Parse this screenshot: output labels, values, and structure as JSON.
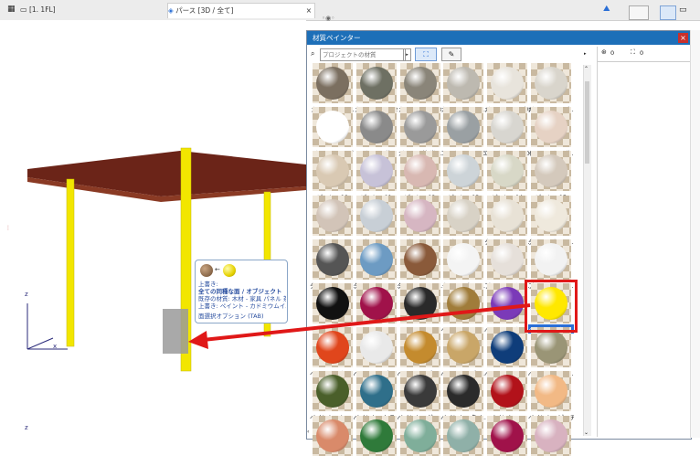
{
  "tabs": [
    {
      "label": "[1. 1FL]"
    },
    {
      "label": "パース [3D / 全て]"
    }
  ],
  "tab_close": "×",
  "panel": {
    "title": "材質ペインター",
    "close": "×",
    "search_placeholder": "プロジェクトの材質",
    "counts": {
      "a": "0",
      "b": "0"
    }
  },
  "tooltip": {
    "line1": "上書き:",
    "line2": "全ての同種な面 / オブジェクト",
    "line3": "既存の材質: 木材 - 家具 パネル 茶",
    "line4": "上書き: ペイント - カドミウムイエロー",
    "line5": "面選択オプション (TAB)"
  },
  "axes": {
    "z": "z",
    "x": "x"
  },
  "materials": [
    {
      "label": "カーペット - 01",
      "color": "#7b6f60"
    },
    {
      "label": "カーペット - 02",
      "color": "#6e7063"
    },
    {
      "label": "カーペット - 03",
      "color": "#8a8579"
    },
    {
      "label": "カーペット - 3...",
      "color": "#bdb9b0"
    },
    {
      "label": "ガラス - シンプル",
      "color": "#e8e4dc"
    },
    {
      "label": "ガラス - シンプ...",
      "color": "#d9d5cc"
    },
    {
      "label": "ガラス - ランプ",
      "color": "#ffffff"
    },
    {
      "label": "ガラス - 鏡",
      "color": "#8a8a8a"
    },
    {
      "label": "ガラス - 鏡 半...",
      "color": "#9a9a9a"
    },
    {
      "label": "コンクリート - 03",
      "color": "#9aa0a3"
    },
    {
      "label": "コンクリート - 04",
      "color": "#d8d6d0"
    },
    {
      "label": "セラミック - 磁...",
      "color": "#e6d2c4"
    },
    {
      "label": "ゾーン - 00",
      "color": "#d9c9b3"
    },
    {
      "label": "ゾーン - 01",
      "color": "#c7c2d8"
    },
    {
      "label": "ゾーン - 02",
      "color": "#d8b8b2"
    },
    {
      "label": "ゾーン - 03",
      "color": "#cdd4d8"
    },
    {
      "label": "ゾーン - 04",
      "color": "#d8d8c7"
    },
    {
      "label": "ゾーン - 05",
      "color": "#d4c9bc"
    },
    {
      "label": "ゾーン - 06",
      "color": "#d2c4b8"
    },
    {
      "label": "ゾーン - 07",
      "color": "#c8cfd6"
    },
    {
      "label": "ゾーン - 08",
      "color": "#d6b6c2"
    },
    {
      "label": "ゾーン - 09",
      "color": "#d8d2c6"
    },
    {
      "label": "タイル - タン 2...",
      "color": "#e8e2d6"
    },
    {
      "label": "タイル - タン 3...",
      "color": "#efe9dd"
    },
    {
      "label": "タイル - チェッ...",
      "color": "#555555"
    },
    {
      "label": "タイル - モザイ...",
      "color": "#6d9bc3"
    },
    {
      "label": "タイル - ライト...",
      "color": "#8a5a3a"
    },
    {
      "label": "タイル - 白 マ...",
      "color": "#f4f4f4"
    },
    {
      "label": "プラスチック - ...",
      "color": "#e6e0da"
    },
    {
      "label": "プラスチック - ...",
      "color": "#f2f2f2"
    },
    {
      "label": "ペイント - ア...",
      "color": "#111111"
    },
    {
      "label": "ペイント - ...",
      "color": "#a0124a"
    },
    {
      "label": "ペイント - ...",
      "color": "#2a2a2a"
    },
    {
      "label": "ペイント - イエ...",
      "color": "#a07c3a"
    },
    {
      "label": "ペイント - ウル...",
      "color": "#7b3ab8"
    },
    {
      "label": "ペイント - カド...",
      "color": "#ffe800"
    },
    {
      "label": "ペイント - カド...",
      "color": "#e0461c"
    },
    {
      "label": "ペイント - グロ...",
      "color": "#e9e9e9"
    },
    {
      "label": "ペイント - ゴー...",
      "color": "#c48b2e"
    },
    {
      "label": "ペイント - ゴー...",
      "color": "#c9a668"
    },
    {
      "label": "ペイント - コバ...",
      "color": "#0f3d7a"
    },
    {
      "label": "ペイント - サン...",
      "color": "#9a9576"
    },
    {
      "label": "ペイント - シェ...",
      "color": "#4a5f2a"
    },
    {
      "label": "ペイント - セラ...",
      "color": "#2f6f8a"
    },
    {
      "label": "ペイント - ダー...",
      "color": "#3a3a3a"
    },
    {
      "label": "ペイント - タイ...",
      "color": "#2b2b2b"
    },
    {
      "label": "ペイント - ...",
      "color": "#b2121a"
    },
    {
      "label": "ペイント - ピーチ",
      "color": "#f2b985"
    },
    {
      "label": "",
      "color": "#d98a6a"
    },
    {
      "label": "",
      "color": "#2f7a3a"
    },
    {
      "label": "",
      "color": "#7fae9a"
    },
    {
      "label": "",
      "color": "#8fb0a8"
    },
    {
      "label": "",
      "color": "#a0124a"
    },
    {
      "label": "",
      "color": "#d8b2c0"
    }
  ],
  "selected_index": 35,
  "colors": {
    "accent": "#1d6fb8",
    "highlight": "#e01818",
    "column": "#f2e600",
    "roof": "#6b2418"
  }
}
